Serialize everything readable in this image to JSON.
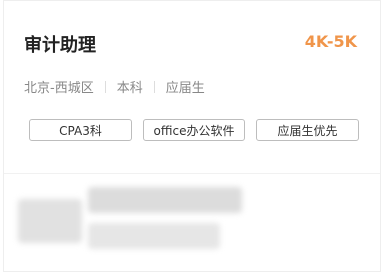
{
  "job": {
    "title": "审计助理",
    "salary": "4K-5K",
    "location": "北京-西城区",
    "education": "本科",
    "experience": "应届生",
    "tags": [
      "CPA3科",
      "office办公软件",
      "应届生优先"
    ]
  },
  "colors": {
    "salary": "#f0954a",
    "title": "#222222",
    "meta": "#888888",
    "tag_border": "#bdbdbd"
  }
}
